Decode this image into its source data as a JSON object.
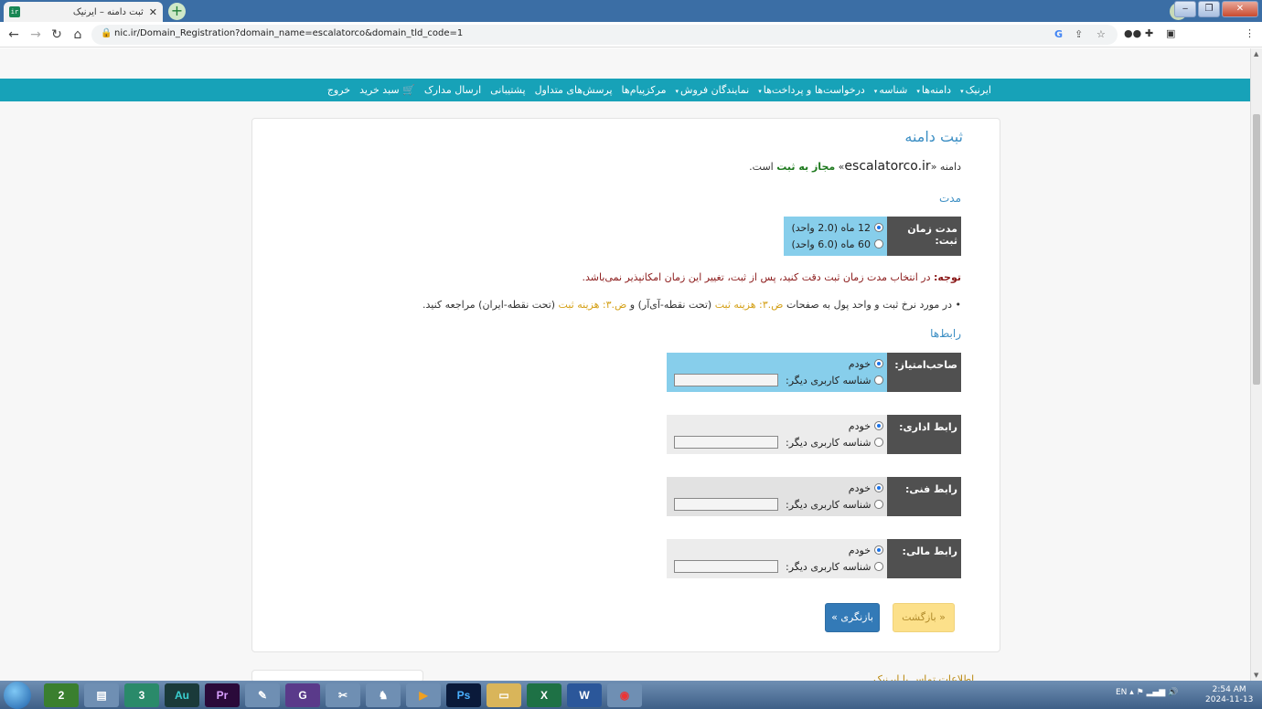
{
  "browser": {
    "tab_title": "ثبت دامنه – ایرنیک",
    "tab_favicon": "ir",
    "tab_close": "✕",
    "new_tab": "+",
    "url": "nic.ir/Domain_Registration?domain_name=escalatorco&domain_tld_code=1",
    "profile_icon": "chevron-down-icon",
    "window_buttons": [
      "‒",
      "❐",
      "✕"
    ]
  },
  "nav": {
    "items": [
      {
        "label": "ایرنیک",
        "caret": "▾"
      },
      {
        "label": "دامنه‌ها",
        "caret": "▾"
      },
      {
        "label": "شناسه",
        "caret": "▾"
      },
      {
        "label": "درخواست‌ها و پرداخت‌ها",
        "caret": "▾"
      },
      {
        "label": "نمایندگان فروش",
        "caret": "▾"
      },
      {
        "label": "مرکزپیام‌ها",
        "caret": ""
      },
      {
        "label": "پرسش‌های متداول",
        "caret": ""
      },
      {
        "label": "پشتیبانی",
        "caret": ""
      },
      {
        "label": "ارسال مدارک",
        "caret": ""
      },
      {
        "label": "سبد خرید",
        "caret": ""
      },
      {
        "label": "خروج",
        "caret": ""
      }
    ]
  },
  "panel": {
    "title": "ثبت دامنه",
    "status_prefix": "دامنه «",
    "domain": "escalatorco.ir",
    "status_mid": "» ",
    "status_ok": "مجاز به ثبت",
    "status_suffix": " است.",
    "duration_heading": "مدت",
    "duration_label": "مدت زمان ثبت:",
    "duration_options": [
      "12 ماه (2.0 واحد)",
      "60 ماه (6.0 واحد)"
    ],
    "note_bold": "توجه:",
    "note_text": " در انتخاب مدت زمان ثبت دقت کنید، پس از ثبت، تغییر این زمان امکانپذیر نمی‌باشد.",
    "info_bullet": "•",
    "info_text1": " در مورد نرخ ثبت و واحد پول به صفحات ",
    "info_link1": "ض.۳: هزینه ثبت",
    "info_text2": " (تحت نقطه-آی‌آر) و ",
    "info_link2": "ض.۳: هزینه ثبت",
    "info_text3": " (تحت نقطه-ایران) مراجعه کنید.",
    "contacts_heading": "رابط‌ها",
    "contacts": [
      {
        "label": "صاحب‌امتیاز:",
        "opt1": "خودم",
        "opt2": "شناسه کاربری دیگر:"
      },
      {
        "label": "رابط اداری:",
        "opt1": "خودم",
        "opt2": "شناسه کاربری دیگر:"
      },
      {
        "label": "رابط فنی:",
        "opt1": "خودم",
        "opt2": "شناسه کاربری دیگر:"
      },
      {
        "label": "رابط مالی:",
        "opt1": "خودم",
        "opt2": "شناسه کاربری دیگر:"
      }
    ],
    "btn_next": "بازنگری »",
    "btn_back": "« بازگشت"
  },
  "footer": {
    "contact_heading": "اطلاعات تماس با ایرنیک"
  },
  "taskbar": {
    "apps": [
      "2",
      "",
      "3",
      "Au",
      "Pr",
      "",
      "G",
      "",
      "",
      "",
      "Ps",
      "",
      "X",
      "W",
      ""
    ],
    "lang": "EN",
    "time": "2:54 AM",
    "date": "2024-11-13"
  }
}
